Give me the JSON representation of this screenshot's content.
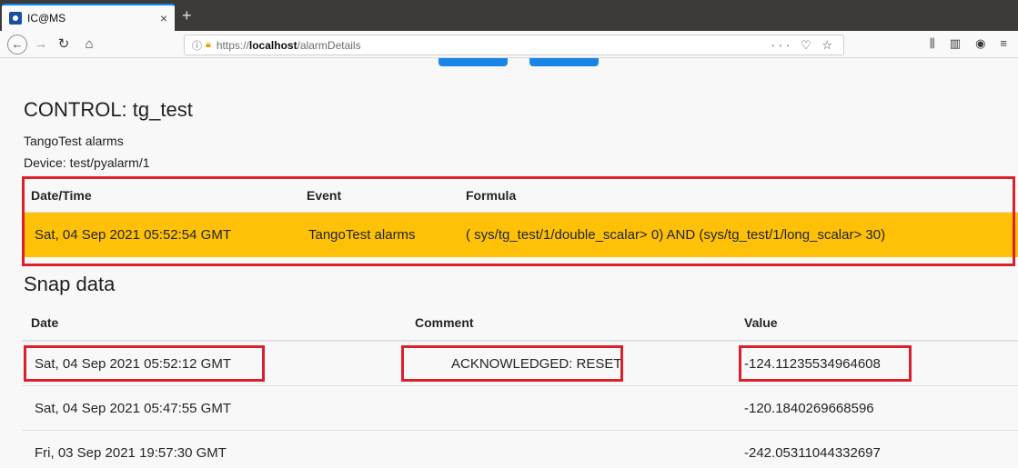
{
  "browser": {
    "tab_title": "IC@MS",
    "tab_close": "×",
    "new_tab": "+",
    "url_scheme": "https://",
    "url_host": "localhost",
    "url_path": "/alarmDetails",
    "url_actions": "··· ♡ ☆",
    "icons": [
      "back-arrow-icon",
      "forward-arrow-icon",
      "reload-icon",
      "home-icon",
      "library-icon",
      "sidebar-icon",
      "account-icon",
      "menu-icon"
    ]
  },
  "page": {
    "title": "CONTROL: tg_test",
    "description": "TangoTest alarms",
    "device": "Device: test/pyalarm/1"
  },
  "alarm_table": {
    "headers": [
      "Date/Time",
      "Event",
      "Formula"
    ],
    "row": {
      "datetime": "Sat, 04 Sep 2021 05:52:54 GMT",
      "event": "TangoTest alarms",
      "formula": "( sys/tg_test/1/double_scalar> 0) AND (sys/tg_test/1/long_scalar> 30)"
    },
    "row_color": "#ffc107"
  },
  "snap": {
    "title": "Snap data",
    "headers": [
      "Date",
      "Comment",
      "Value"
    ],
    "rows": [
      {
        "date": "Sat, 04 Sep 2021 05:52:12 GMT",
        "comment": "ACKNOWLEDGED: RESET",
        "value": "-124.11235534964608"
      },
      {
        "date": "Sat, 04 Sep 2021 05:47:55 GMT",
        "comment": "",
        "value": "-120.1840269668596"
      },
      {
        "date": "Fri, 03 Sep 2021 19:57:30 GMT",
        "comment": "",
        "value": "-242.05311044332697"
      }
    ]
  },
  "colors": {
    "accent": "#1a85e8",
    "highlight_box": "#d9202b"
  }
}
